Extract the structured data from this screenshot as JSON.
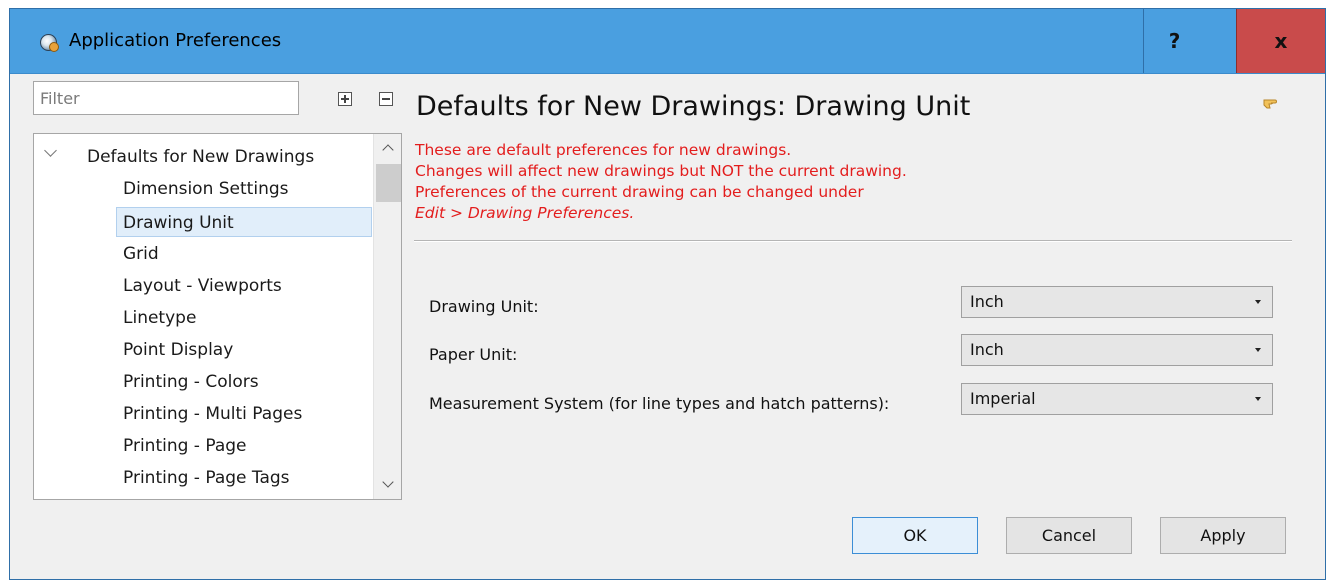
{
  "window": {
    "title": "Application Preferences",
    "help_label": "?",
    "close_label": "x"
  },
  "filter": {
    "placeholder": "Filter"
  },
  "tree": {
    "category": "Defaults for New Drawings",
    "items": [
      {
        "label": "Dimension Settings"
      },
      {
        "label": "Drawing Unit",
        "selected": true
      },
      {
        "label": "Grid"
      },
      {
        "label": "Layout - Viewports"
      },
      {
        "label": "Linetype"
      },
      {
        "label": "Point Display"
      },
      {
        "label": "Printing - Colors"
      },
      {
        "label": "Printing - Multi Pages"
      },
      {
        "label": "Printing - Page"
      },
      {
        "label": "Printing - Page Tags"
      }
    ]
  },
  "main": {
    "title": "Defaults for New Drawings: Drawing Unit",
    "notice": {
      "line1": "These are default preferences for new drawings.",
      "line2": "Changes will affect new drawings but NOT the current drawing.",
      "line3": "Preferences of the current drawing can be changed under",
      "line4": "Edit > Drawing Preferences."
    },
    "fields": [
      {
        "label": "Drawing Unit:",
        "value": "Inch"
      },
      {
        "label": "Paper Unit:",
        "value": "Inch"
      },
      {
        "label": "Measurement System (for line types and hatch patterns):",
        "value": "Imperial"
      }
    ]
  },
  "buttons": {
    "ok": "OK",
    "cancel": "Cancel",
    "apply": "Apply"
  },
  "colors": {
    "titlebar": "#4a9fe0",
    "close": "#c94b4b",
    "notice": "#e31d1d",
    "selection": "#e1eefa"
  }
}
